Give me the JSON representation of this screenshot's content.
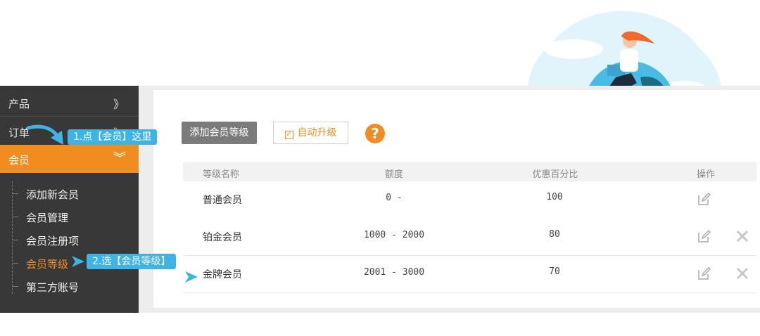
{
  "sidebar": {
    "items": [
      {
        "label": "产品",
        "icon": "chevron-right-icon",
        "glyph": "》"
      },
      {
        "label": "订单",
        "icon": "chevron-right-icon",
        "glyph": "》"
      },
      {
        "label": "会员",
        "icon": "chevron-down-icon",
        "glyph": "︾"
      }
    ],
    "sub_items": [
      {
        "label": "添加新会员"
      },
      {
        "label": "会员管理"
      },
      {
        "label": "会员注册项"
      },
      {
        "label": "会员等级",
        "active": true
      },
      {
        "label": "第三方账号"
      }
    ]
  },
  "callouts": {
    "step1": "1.点【会员】这里",
    "step2": "2.选【会员等级】"
  },
  "toolbar": {
    "add_label": "添加会员等级",
    "auto_upgrade_label": "自动升级",
    "auto_upgrade_checked": true,
    "help_glyph": "?"
  },
  "table": {
    "headers": {
      "name": "等级名称",
      "amount": "额度",
      "percent": "优惠百分比",
      "ops": "操作"
    },
    "rows": [
      {
        "name": "普通会员",
        "amount": "0 -",
        "percent": "100",
        "deletable": false
      },
      {
        "name": "铂金会员",
        "amount": "1000 - 2000",
        "percent": "80",
        "deletable": true
      },
      {
        "name": "金牌会员",
        "amount": "2001 - 3000",
        "percent": "70",
        "deletable": true
      }
    ]
  },
  "colors": {
    "accent": "#f18c21",
    "sidebar_bg": "#383838",
    "callout": "#3fb4e4",
    "button_gray": "#7b7b7b"
  }
}
